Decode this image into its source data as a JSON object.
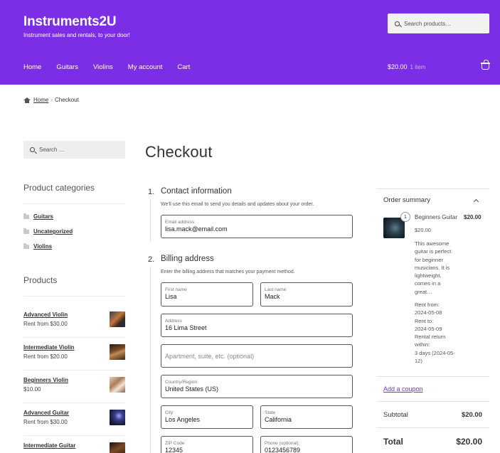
{
  "site": {
    "title": "Instruments2U",
    "tagline": "Instrument sales and rentals, to your door!",
    "search_placeholder": "Search products…",
    "brand_color": "#7c2ee6"
  },
  "nav": {
    "items": [
      "Home",
      "Guitars",
      "Violins",
      "My account",
      "Cart"
    ]
  },
  "cart": {
    "total": "$20.00",
    "count": "1 item",
    "icon": "basket-icon"
  },
  "breadcrumb": {
    "home": "Home",
    "separator": "›",
    "current": "Checkout"
  },
  "sidebar": {
    "search_placeholder": "Search …",
    "categories_title": "Product categories",
    "categories": [
      "Guitars",
      "Uncategorized",
      "Violins"
    ],
    "products_title": "Products",
    "products": [
      {
        "name": "Advanced Violin",
        "price": "Rent from $30.00"
      },
      {
        "name": "Intermediate Violin",
        "price": "Rent from $20.00"
      },
      {
        "name": "Beginners Violin",
        "price": "$10.00"
      },
      {
        "name": "Advanced Guitar",
        "price": "Rent from $30.00"
      },
      {
        "name": "Intermediate Guitar",
        "price": ""
      }
    ]
  },
  "checkout": {
    "title": "Checkout",
    "contact": {
      "number": "1.",
      "title": "Contact information",
      "description": "We'll use this email to send you details and updates about your order.",
      "email_label": "Email address",
      "email_value": "lisa.mack@email.com"
    },
    "billing": {
      "number": "2.",
      "title": "Billing address",
      "description": "Enter the billing address that matches your payment method.",
      "first_name_label": "First name",
      "first_name_value": "Lisa",
      "last_name_label": "Last name",
      "last_name_value": "Mack",
      "address_label": "Address",
      "address_value": "16 Lima Street",
      "apartment_placeholder": "Apartment, suite, etc. (optional)",
      "country_label": "Country/Region",
      "country_value": "United States (US)",
      "city_label": "City",
      "city_value": "Los Angeles",
      "state_label": "State",
      "state_value": "California",
      "zip_label": "ZIP Code",
      "zip_value": "12345",
      "phone_label": "Phone (optional)",
      "phone_value": "0123456789"
    }
  },
  "summary": {
    "title": "Order summary",
    "item": {
      "qty": "1",
      "name": "Beginners Guitar",
      "price": "$20.00",
      "unit_price": "$20.00",
      "description_lines": [
        "This awesome",
        "guitar is perfect",
        "for beginner",
        "musicians. It is",
        "lightweight,",
        "comes in a",
        "great…"
      ],
      "rental_lines": [
        "Rent from:",
        "2024-05-08",
        "Rent to:",
        "2024-05-09",
        "Rental return",
        "within:",
        "3 days (2024-05-",
        "12)"
      ]
    },
    "coupon_link": "Add a coupon",
    "subtotal_label": "Subtotal",
    "subtotal_value": "$20.00",
    "total_label": "Total",
    "total_value": "$20.00"
  }
}
